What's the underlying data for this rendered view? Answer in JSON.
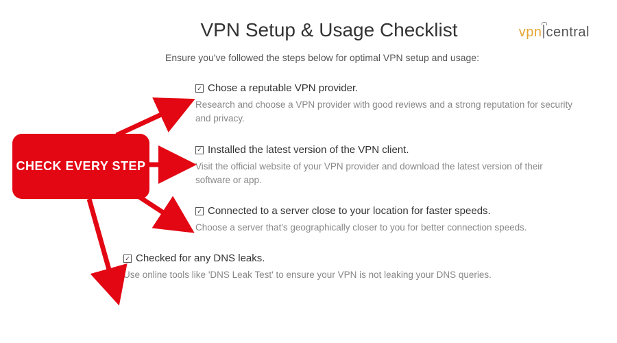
{
  "header": {
    "title": "VPN Setup & Usage Checklist",
    "subtitle": "Ensure you've followed the steps below for optimal VPN setup and usage:"
  },
  "logo": {
    "part1": "vpn",
    "part2": "central"
  },
  "callout": {
    "text": "CHECK EVERY STEP"
  },
  "checklist": [
    {
      "checked": true,
      "title": "Chose a reputable VPN provider.",
      "description": "Research and choose a VPN provider with good reviews and a strong reputation for security and privacy."
    },
    {
      "checked": true,
      "title": "Installed the latest version of the VPN client.",
      "description": "Visit the official website of your VPN provider and download the latest version of their software or app."
    },
    {
      "checked": true,
      "title": "Connected to a server close to your location for faster speeds.",
      "description": "Choose a server that's geographically closer to you for better connection speeds."
    },
    {
      "checked": true,
      "title": "Checked for any DNS leaks.",
      "description": "Use online tools like 'DNS Leak Test' to ensure your VPN is not leaking your DNS queries."
    }
  ],
  "colors": {
    "accent_red": "#e30613",
    "logo_orange": "#e6a532"
  }
}
